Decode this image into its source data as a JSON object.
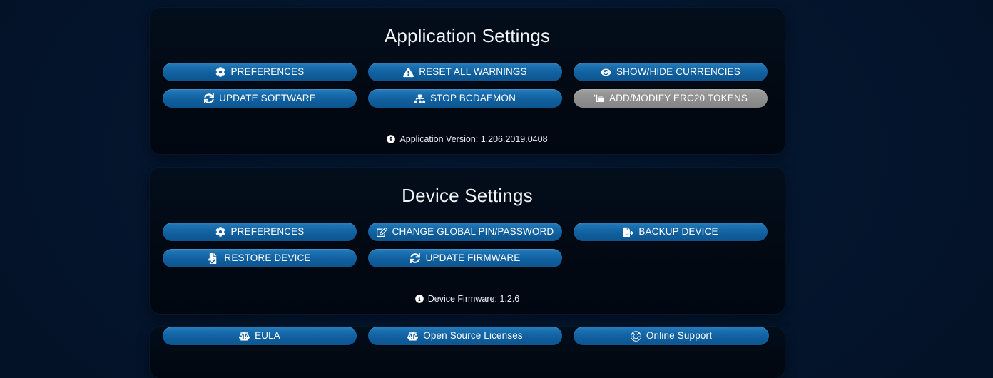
{
  "app": {
    "background_color": "#04142b",
    "panel_color": "#020913",
    "accent_color": "#1a6fb0",
    "disabled_color": "#949494"
  },
  "application_settings": {
    "title": "Application Settings",
    "buttons": [
      {
        "label": "PREFERENCES",
        "icon": "gear-icon",
        "name": "app-preferences-button",
        "disabled": false
      },
      {
        "label": "RESET ALL WARNINGS",
        "icon": "warning-icon",
        "name": "reset-all-warnings-button",
        "disabled": false
      },
      {
        "label": "SHOW/HIDE CURRENCIES",
        "icon": "eye-icon",
        "name": "show-hide-currencies-button",
        "disabled": false
      },
      {
        "label": "UPDATE SOFTWARE",
        "icon": "refresh-icon",
        "name": "update-software-button",
        "disabled": false
      },
      {
        "label": "STOP BCDAEMON",
        "icon": "sitemap-icon",
        "name": "stop-bcdaemon-button",
        "disabled": false
      },
      {
        "label": "ADD/MODIFY ERC20 TOKENS",
        "icon": "scroll-icon",
        "name": "add-modify-erc20-tokens-button",
        "disabled": true
      }
    ],
    "note": "Application Version: 1.206.2019.0408",
    "note_icon": "info-icon"
  },
  "device_settings": {
    "title": "Device Settings",
    "buttons": [
      {
        "label": "PREFERENCES",
        "icon": "gear-icon",
        "name": "device-preferences-button",
        "disabled": false
      },
      {
        "label": "CHANGE GLOBAL PIN/PASSWORD",
        "icon": "edit-square-icon",
        "name": "change-global-pin-password-button",
        "disabled": false
      },
      {
        "label": "BACKUP DEVICE",
        "icon": "file-export-icon",
        "name": "backup-device-button",
        "disabled": false
      },
      {
        "label": "RESTORE DEVICE",
        "icon": "file-import-icon",
        "name": "restore-device-button",
        "disabled": false
      },
      {
        "label": "UPDATE FIRMWARE",
        "icon": "refresh-icon",
        "name": "update-firmware-button",
        "disabled": false
      }
    ],
    "note": "Device Firmware: 1.2.6",
    "note_icon": "info-icon"
  },
  "legal": {
    "buttons": [
      {
        "label": "EULA",
        "icon": "balance-scale-icon",
        "name": "eula-button"
      },
      {
        "label": "Open Source Licenses",
        "icon": "balance-scale-icon",
        "name": "open-source-licenses-button"
      },
      {
        "label": "Online Support",
        "icon": "life-ring-icon",
        "name": "online-support-button"
      }
    ]
  }
}
